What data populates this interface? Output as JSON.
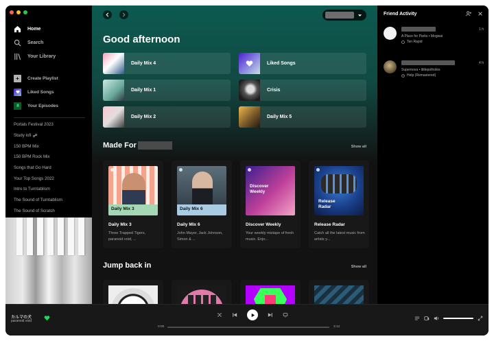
{
  "sidebar": {
    "nav": [
      {
        "label": "Home",
        "icon": "home-icon",
        "active": true
      },
      {
        "label": "Search",
        "icon": "search-icon",
        "active": false
      },
      {
        "label": "Your Library",
        "icon": "library-icon",
        "active": false
      }
    ],
    "actions": [
      {
        "label": "Create Playlist",
        "icon": "plus-icon",
        "color": "#b3b3b3"
      },
      {
        "label": "Liked Songs",
        "icon": "heart-icon",
        "color": "#5b3fd6"
      },
      {
        "label": "Your Episodes",
        "icon": "bookmark-icon",
        "color": "#1f6f3a"
      }
    ],
    "playlists": [
      "Portals Festival 2023",
      "Study lofi",
      "150 BPM Mix",
      "150 BPM Rock Mix",
      "Songs that Go Hard",
      "Your Top Songs 2022",
      "Intro to Turntablism",
      "The Sound of Turntablism",
      "The Sound of Scratch"
    ]
  },
  "main": {
    "greeting": "Good afternoon",
    "quick": [
      {
        "label": "Daily Mix 4"
      },
      {
        "label": "Liked Songs"
      },
      {
        "label": "Daily Mix 1"
      },
      {
        "label": "Crisis"
      },
      {
        "label": "Daily Mix 2"
      },
      {
        "label": "Daily Mix 5"
      }
    ],
    "made_for": {
      "title": "Made For",
      "show_all": "Show all",
      "cards": [
        {
          "title": "Daily Mix 3",
          "art_label": "Daily Mix 3",
          "desc": "Three Trapped Tigers, paranoid void, ..."
        },
        {
          "title": "Daily Mix 6",
          "art_label": "Daily Mix 6",
          "desc": "John Mayer, Jack Johnson, Simon & ..."
        },
        {
          "title": "Discover Weekly",
          "art_label": "Discover Weekly",
          "desc": "Your weekly mixtape of fresh music. Enjo..."
        },
        {
          "title": "Release Radar",
          "art_label": "Release Radar",
          "desc": "Catch all the latest music from artists y..."
        }
      ]
    },
    "jump_back": {
      "title": "Jump back in",
      "show_all": "Show all"
    }
  },
  "friends": {
    "title": "Friend Activity",
    "items": [
      {
        "line": "A Place for Parks • Mogwai",
        "context": "Ten Rapid",
        "time": "1 h"
      },
      {
        "line": "Supernova • littlepotholes",
        "context": "Help (Remastered)",
        "time": "4 h"
      }
    ]
  },
  "player": {
    "title": "カルマの犬",
    "artist": "paranoid void",
    "elapsed": "0:00",
    "duration": "3:12",
    "accent": "#1ed760"
  }
}
